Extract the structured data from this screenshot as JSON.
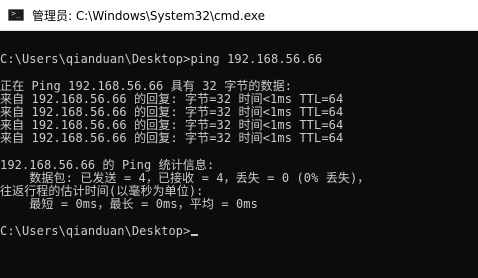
{
  "window": {
    "title": "管理员: C:\\Windows\\System32\\cmd.exe",
    "icon": "cmd-icon"
  },
  "console": {
    "lines": [
      "",
      "C:\\Users\\qianduan\\Desktop>ping 192.168.56.66",
      "",
      "正在 Ping 192.168.56.66 具有 32 字节的数据:",
      "来自 192.168.56.66 的回复: 字节=32 时间<1ms TTL=64",
      "来自 192.168.56.66 的回复: 字节=32 时间<1ms TTL=64",
      "来自 192.168.56.66 的回复: 字节=32 时间<1ms TTL=64",
      "来自 192.168.56.66 的回复: 字节=32 时间<1ms TTL=64",
      "",
      "192.168.56.66 的 Ping 统计信息:",
      "    数据包: 已发送 = 4，已接收 = 4，丢失 = 0 (0% 丢失)，",
      "往返行程的估计时间(以毫秒为单位):",
      "    最短 = 0ms，最长 = 0ms，平均 = 0ms",
      "",
      "C:\\Users\\qianduan\\Desktop>"
    ]
  },
  "colors": {
    "background": "#0c0c0c",
    "text": "#cccccc",
    "titlebar": "#ffffff"
  }
}
